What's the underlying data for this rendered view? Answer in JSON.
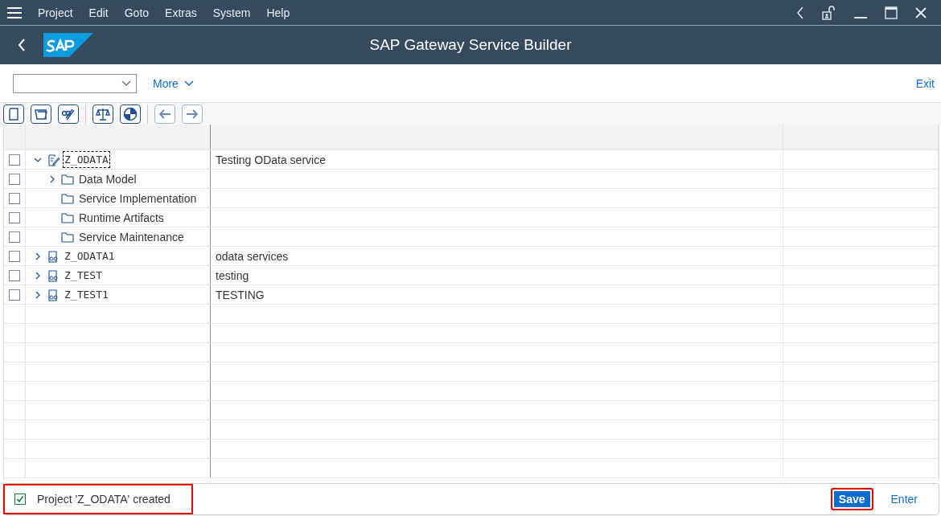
{
  "menu": [
    "Project",
    "Edit",
    "Goto",
    "Extras",
    "System",
    "Help"
  ],
  "title": "SAP Gateway Service Builder",
  "toolbar": {
    "more": "More",
    "exit": "Exit"
  },
  "icon_buttons": [
    {
      "kind": "new",
      "disabled": false
    },
    {
      "kind": "open",
      "disabled": false
    },
    {
      "kind": "edit",
      "disabled": false
    },
    {
      "kind": "sep"
    },
    {
      "kind": "compare",
      "disabled": false
    },
    {
      "kind": "status",
      "disabled": false
    },
    {
      "kind": "sep"
    },
    {
      "kind": "back",
      "disabled": true
    },
    {
      "kind": "forward",
      "disabled": true
    }
  ],
  "tree": [
    {
      "kind": "project-edit",
      "name": "Z_ODATA",
      "description": "Testing OData service",
      "expanded": true,
      "focused": true,
      "checked": false,
      "children": [
        {
          "kind": "folder",
          "name": "Data Model",
          "expanded": false,
          "focused": false,
          "checked": false
        },
        {
          "kind": "folder",
          "name": "Service Implementation",
          "focused": false,
          "checked": false
        },
        {
          "kind": "folder",
          "name": "Runtime Artifacts",
          "focused": false,
          "checked": false
        },
        {
          "kind": "folder",
          "name": "Service Maintenance",
          "focused": false,
          "checked": false
        }
      ]
    },
    {
      "kind": "project",
      "name": "Z_ODATA1",
      "description": "odata services",
      "expanded": false,
      "focused": false,
      "checked": false
    },
    {
      "kind": "project",
      "name": "Z_TEST",
      "description": "testing",
      "expanded": false,
      "focused": false,
      "checked": false
    },
    {
      "kind": "project",
      "name": "Z_TEST1",
      "description": "TESTING",
      "expanded": false,
      "focused": false,
      "checked": false
    }
  ],
  "status_bar": {
    "message": "Project 'Z_ODATA' created",
    "highlighted": true,
    "buttons": [
      {
        "label": "Save",
        "primary": true,
        "highlighted": true
      },
      {
        "label": "Enter",
        "primary": false,
        "highlighted": false
      }
    ]
  }
}
